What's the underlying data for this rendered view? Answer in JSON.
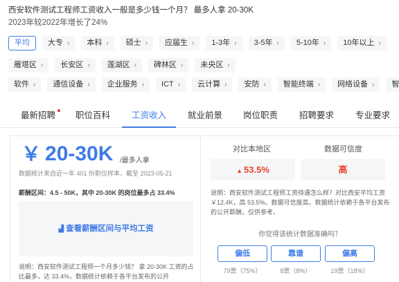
{
  "header": {
    "title": "西安软件测试工程师工资收入一般是多少钱一个月？ 最多人拿 20-30K",
    "subtitle": "2023年较2022年增长了24%"
  },
  "filters": {
    "education": [
      {
        "label": "平均",
        "active": true
      },
      {
        "label": "大专"
      },
      {
        "label": "本科"
      },
      {
        "label": "硕士"
      },
      {
        "label": "应届生"
      },
      {
        "label": "1-3年"
      },
      {
        "label": "3-5年"
      },
      {
        "label": "5-10年"
      },
      {
        "label": "10年以上"
      }
    ],
    "districts": [
      {
        "label": "雁塔区"
      },
      {
        "label": "长安区"
      },
      {
        "label": "莲湖区"
      },
      {
        "label": "碑林区"
      },
      {
        "label": "未央区"
      }
    ],
    "industries": [
      {
        "label": "软件"
      },
      {
        "label": "通信设备"
      },
      {
        "label": "企业服务"
      },
      {
        "label": "ICT"
      },
      {
        "label": "云计算"
      },
      {
        "label": "安防"
      },
      {
        "label": "智能终端"
      },
      {
        "label": "网络设备"
      },
      {
        "label": "智"
      }
    ]
  },
  "tabs": [
    {
      "label": "最新招聘",
      "dot": true
    },
    {
      "label": "职位百科"
    },
    {
      "label": "工资收入",
      "active": true
    },
    {
      "label": "就业前景"
    },
    {
      "label": "岗位职责"
    },
    {
      "label": "招聘要求"
    },
    {
      "label": "专业要求"
    }
  ],
  "salary": {
    "symbol": "￥",
    "range": "20-30K",
    "note": "/最多人拿",
    "stat": "数据统计来自近一年 401 份职位样本，截至 2023-05-21",
    "distribution": "薪酬区间：4.5 - 50K，其中 20-30K 的岗位最多占 33.4%",
    "chart_link": "查看薪酬区间与平均工资",
    "description": "说明：西安软件测试工程师一个月多少钱？ 拿 20-30K 工资的占比最多，达 33.4%，数据统计依赖于各平台发布的公开"
  },
  "compare": {
    "local_title": "对比本地区",
    "local_value": "53.5%",
    "trust_title": "数据可信度",
    "trust_value": "高",
    "description": "说明：西安软件测试工程师工资待遇怎么样？对比西安平均工资 ￥12.4K，高 53.5%。数据可信度高。数据统计依赖于各平台发布的公开薪酬，仅供参考。",
    "question": "你觉得该统计数据准确吗？"
  },
  "votes": [
    {
      "label": "偏低",
      "count": "79票（75%）"
    },
    {
      "label": "靠谱",
      "count": "8票（8%）"
    },
    {
      "label": "偏高",
      "count": "19票（18%）"
    }
  ],
  "colors": {
    "accent": "#3f7be6",
    "highlight": "#e8452c",
    "dot": "#e0383e"
  },
  "icons": {
    "chart": "bar-chart-icon",
    "trend": "arrow-up-icon",
    "chevron": "chevron-right-icon"
  }
}
